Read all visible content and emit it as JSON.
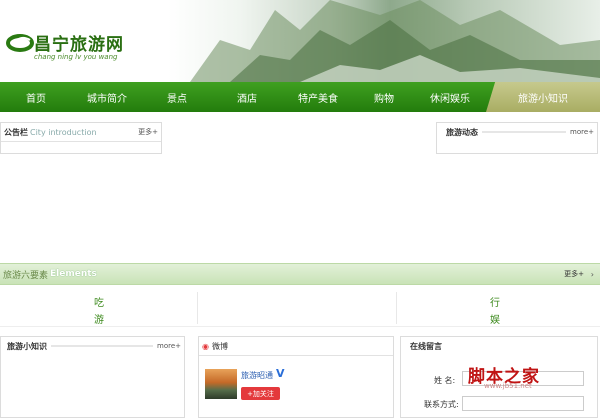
{
  "header": {
    "logo_title": "昌宁旅游网",
    "logo_sub": "chang ning lv you wang"
  },
  "nav": {
    "items": [
      "首页",
      "城市简介",
      "景点",
      "酒店",
      "特产美食",
      "购物",
      "休闲娱乐",
      "旅游小知识"
    ],
    "active_index": 7
  },
  "notice": {
    "title": "公告栏",
    "en": "City introduction",
    "more": "更多+"
  },
  "news": {
    "title": "旅游动态",
    "more": "more+"
  },
  "elements": {
    "title_cn": "旅游六要素",
    "title_en": "Elements",
    "more": "更多+",
    "chars": [
      "吃",
      "游",
      "行",
      "娱"
    ]
  },
  "tips": {
    "title": "旅游小知识",
    "more": "more+"
  },
  "weibo": {
    "title": "微博",
    "account": "旅游昭通",
    "verified": "V",
    "follow": "+加关注"
  },
  "message": {
    "title": "在线留言",
    "name_label": "姓 名:",
    "contact_label": "联系方式:"
  },
  "watermark": {
    "text": "脚本之家",
    "url": "www.jb51.net"
  },
  "colors": {
    "nav_green": "#2f8d14",
    "accent_red": "#e4393c",
    "active_tab": "#b4b86f"
  }
}
